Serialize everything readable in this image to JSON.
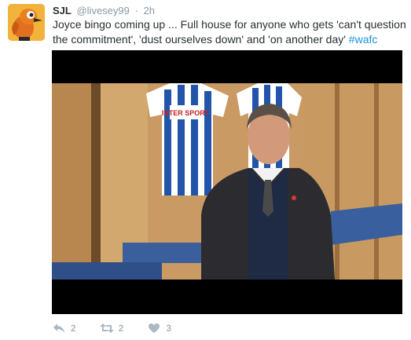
{
  "tweet": {
    "author_name": "SJL",
    "author_handle": "@livesey99",
    "separator": "·",
    "timestamp": "2h",
    "text": "Joyce bingo coming up ... Full house for anyone who gets 'can't question the commitment', 'dust ourselves down' and 'on another day' ",
    "hashtag": "#wafc",
    "avatar_icon": "cartoon-bird-avatar",
    "media": {
      "type": "video",
      "jersey_sponsor": "INTER SPORT"
    },
    "actions": {
      "reply": {
        "icon": "reply-icon",
        "count": "2"
      },
      "retweet": {
        "icon": "retweet-icon",
        "count": "2"
      },
      "like": {
        "icon": "heart-icon",
        "count": "3"
      }
    }
  },
  "colors": {
    "text": "#292f33",
    "muted": "#8899a6",
    "link": "#1b95e0",
    "action": "#aab8c2"
  }
}
